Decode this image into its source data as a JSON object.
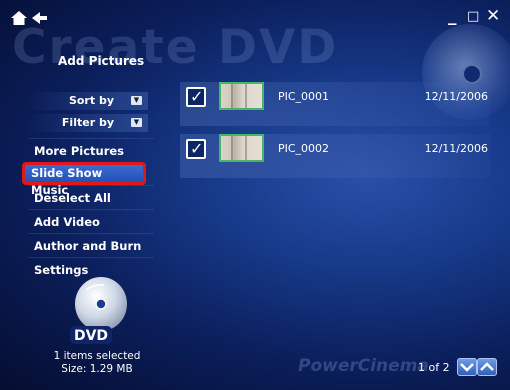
{
  "window": {
    "watermark_text": "Create DVD",
    "minimize_label": "_",
    "restore_label": "□",
    "close_label": "✕"
  },
  "header": {
    "title": "Add Pictures"
  },
  "sort": {
    "sort_by_label": "Sort by",
    "filter_by_label": "Filter by"
  },
  "menu": {
    "items": [
      {
        "label": "More Pictures"
      },
      {
        "label": "Slide Show Music",
        "selected": true
      },
      {
        "label": "Deselect All"
      },
      {
        "label": "Add Video"
      },
      {
        "label": "Author and Burn"
      },
      {
        "label": "Settings"
      }
    ]
  },
  "dvd_badge": {
    "label": "DVD"
  },
  "selection": {
    "count_text": "1 items selected",
    "size_text": "Size: 1.29 MB"
  },
  "files": [
    {
      "name": "PIC_0001",
      "date": "12/11/2006",
      "checked": true
    },
    {
      "name": "PIC_0002",
      "date": "12/11/2006",
      "checked": true
    }
  ],
  "pager": {
    "text": "1 of 2"
  },
  "brand": {
    "text": "PowerCinema"
  },
  "icons": {
    "home": "home-icon",
    "back": "back-arrow-icon",
    "check": "check-icon",
    "page_down": "chevron-down-icon",
    "page_up": "chevron-up-icon"
  },
  "colors": {
    "highlight_border": "#e01818",
    "selected_bg": "#2f5fc4",
    "thumb_border": "#49b56b"
  }
}
